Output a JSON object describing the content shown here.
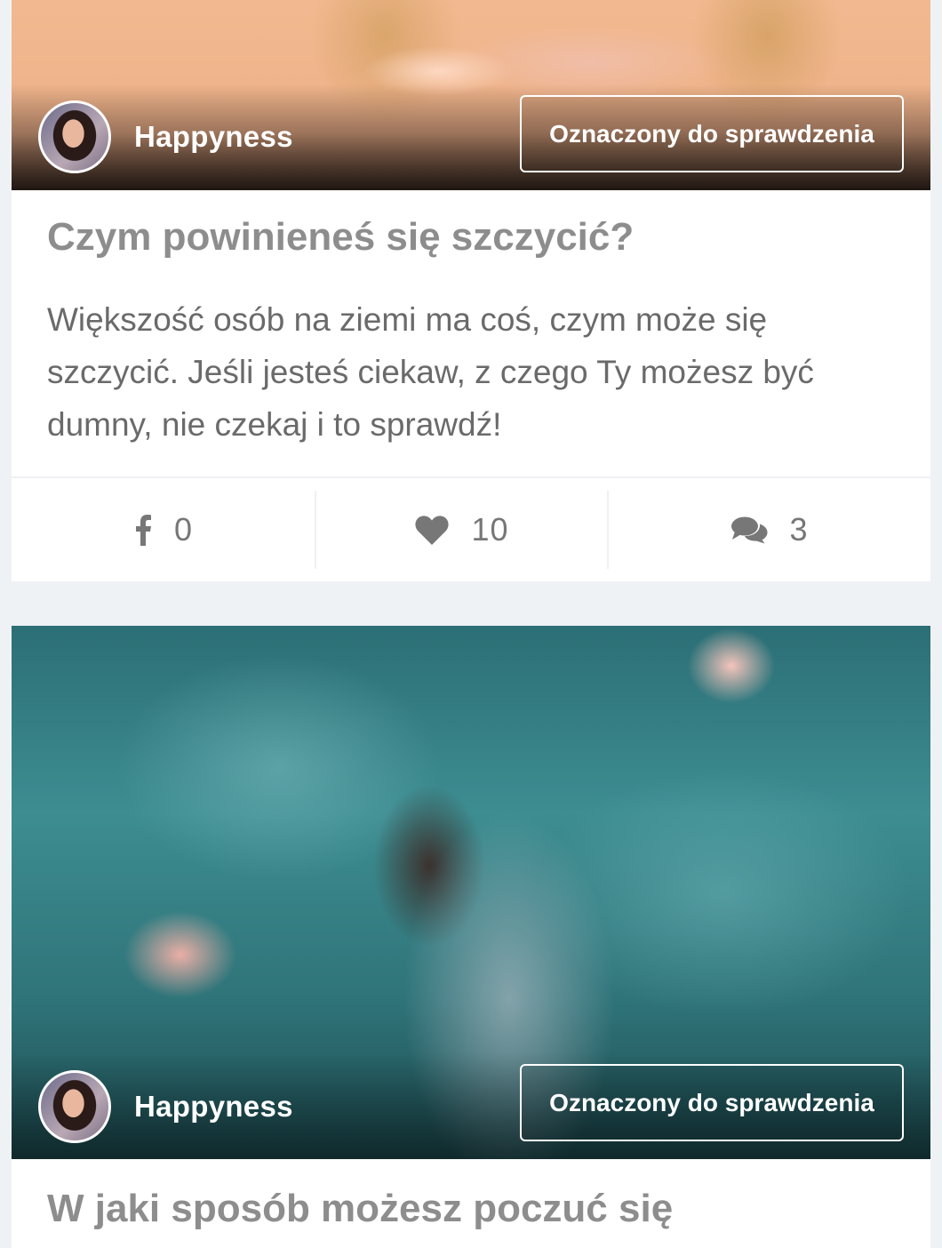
{
  "posts": [
    {
      "author": "Happyness",
      "badge": "Oznaczony do sprawdzenia",
      "title": "Czym powinieneś się szczycić?",
      "description": "Większość osób na ziemi ma coś, czym może się szczycić. Jeśli jesteś ciekaw, z czego Ty możesz być dumny, nie czekaj i to sprawdź!",
      "stats": {
        "facebook": "0",
        "likes": "10",
        "comments": "3"
      }
    },
    {
      "author": "Happyness",
      "badge": "Oznaczony do sprawdzenia",
      "title": "W jaki sposób możesz poczuć się"
    }
  ],
  "icons": {
    "facebook": "facebook-icon",
    "like": "heart-icon",
    "comments": "comments-icon"
  },
  "colors": {
    "background": "#eff2f5",
    "title": "#8d8d8d",
    "text": "#6a6a6a",
    "icon": "#777777"
  }
}
